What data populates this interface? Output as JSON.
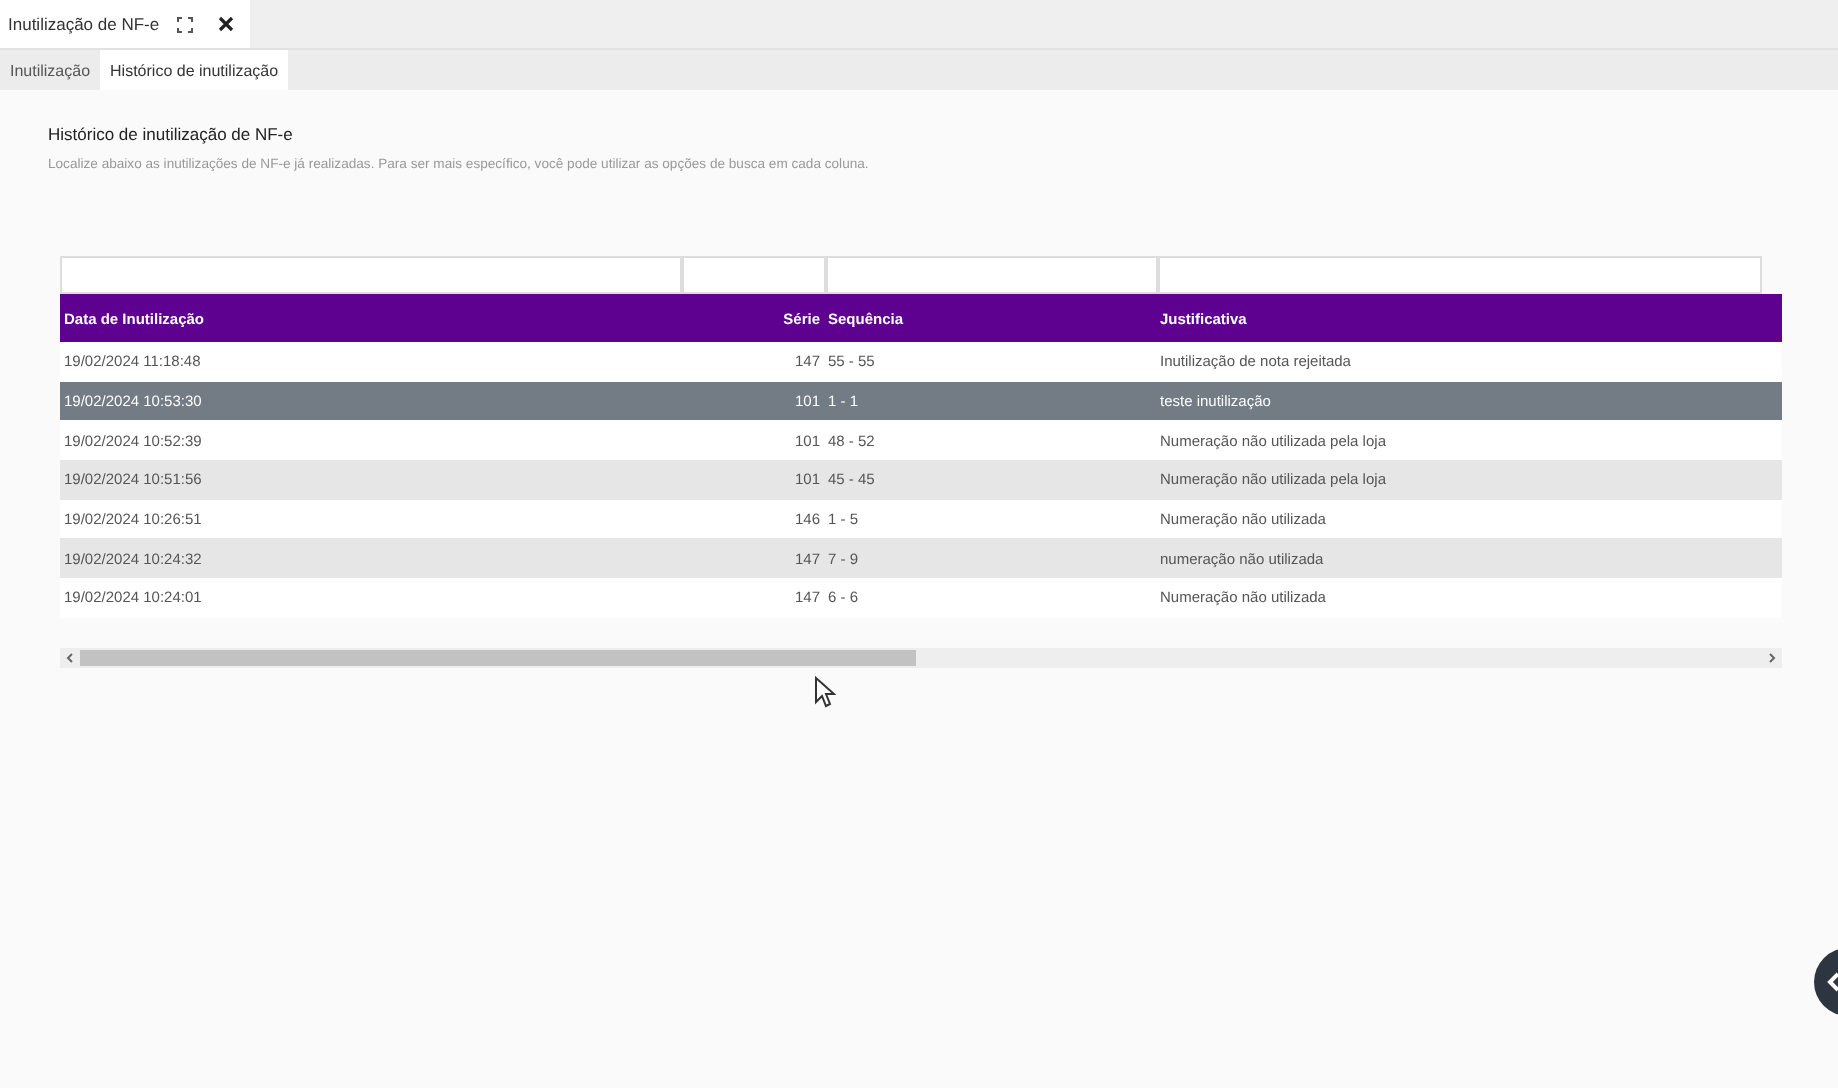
{
  "document_tab": {
    "title": "Inutilização de NF-e"
  },
  "tabs": [
    {
      "label": "Inutilização",
      "selected": false
    },
    {
      "label": "Histórico de inutilização",
      "selected": true
    }
  ],
  "heading": "Histórico de inutilização de NF-e",
  "description": "Localize abaixo as inutilizações de NF-e já realizadas. Para ser mais específico, você pode utilizar as opções de busca em cada coluna.",
  "table": {
    "columns": [
      "Data de Inutilização",
      "Série",
      "Sequência",
      "Justificativa"
    ],
    "rows": [
      {
        "cells": [
          "19/02/2024 11:18:48",
          "147",
          "55 - 55",
          "Inutilização de nota rejeitada"
        ],
        "selected": false
      },
      {
        "cells": [
          "19/02/2024 10:53:30",
          "101",
          "1 - 1",
          "teste inutilização"
        ],
        "selected": true
      },
      {
        "cells": [
          "19/02/2024 10:52:39",
          "101",
          "48 - 52",
          "Numeração não utilizada pela loja"
        ],
        "selected": false
      },
      {
        "cells": [
          "19/02/2024 10:51:56",
          "101",
          "45 - 45",
          "Numeração não utilizada pela loja"
        ],
        "selected": false
      },
      {
        "cells": [
          "19/02/2024 10:26:51",
          "146",
          "1 - 5",
          "Numeração não utilizada"
        ],
        "selected": false
      },
      {
        "cells": [
          "19/02/2024 10:24:32",
          "147",
          "7 - 9",
          "numeração não utilizada"
        ],
        "selected": false
      },
      {
        "cells": [
          "19/02/2024 10:24:01",
          "147",
          "6 - 6",
          "Numeração não utilizada"
        ],
        "selected": false
      }
    ]
  }
}
